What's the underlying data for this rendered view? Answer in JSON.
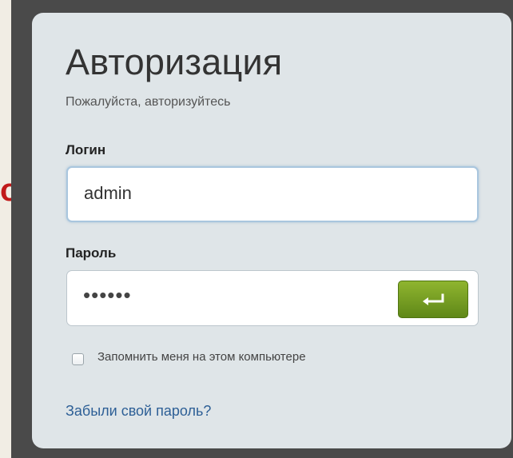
{
  "stray_text": "о",
  "auth": {
    "title": "Авторизация",
    "subtitle": "Пожалуйста, авторизуйтесь",
    "login_label": "Логин",
    "login_value": "admin",
    "password_label": "Пароль",
    "password_value": "••••••",
    "remember_label": "Запомнить меня на этом компьютере",
    "remember_checked": false,
    "forgot_link": "Забыли свой пароль?",
    "submit_icon": "enter-arrow-icon"
  },
  "colors": {
    "panel_bg": "#dfe5e8",
    "frame": "#4a4a4a",
    "submit_button": "#7aa123",
    "link": "#2d5f96",
    "stray_text": "#c11a1a"
  }
}
